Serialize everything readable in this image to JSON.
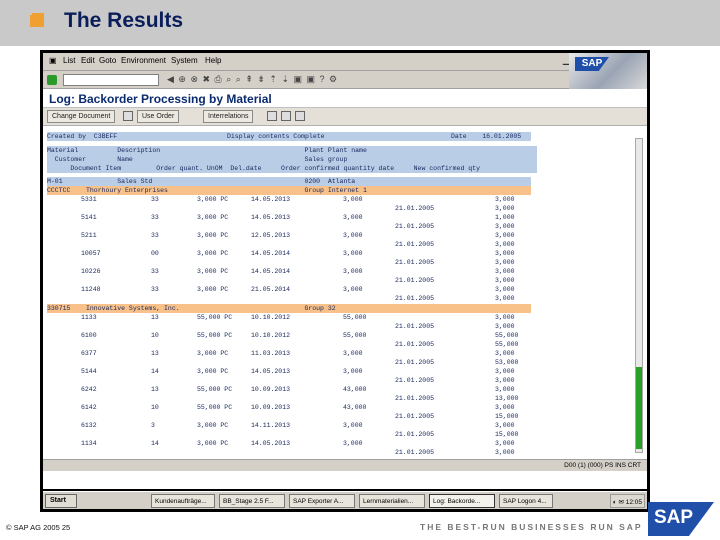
{
  "slide": {
    "title": "The Results",
    "footer_copyright": "© SAP AG 2005 25",
    "footer_tagline": "THE BEST-RUN BUSINESSES RUN SAP",
    "logo_text": "SAP"
  },
  "menu": [
    "List",
    "Edit",
    "Goto",
    "Environment",
    "System",
    "Help"
  ],
  "app": {
    "title": "Log: Backorder Processing by Material",
    "buttons": [
      "Change Document",
      "Use Order",
      "Interrelations"
    ]
  },
  "report": {
    "header_left": "Created by  C3BEFF",
    "header_mid": "Display contents Complete",
    "header_right": "Date    16.01.2005",
    "column_lines": [
      "Material          Description                                     Plant Plant name",
      "  Customer        Name                                            Sales group",
      "      Document Item         Order quant. UnOM  Del.date     Order confirmed quantity date     New confirmed qty"
    ],
    "group1": "M-01              Sales Std                                       0200  Atlanta",
    "customer1": "CCCTCC    Thorhoury Enterprises                                   Group Internet 1",
    "rows1": [
      {
        "doc": "5331",
        "item": "33",
        "qty": "3,000 PC",
        "date": "14.05.2013",
        "conf": "3,000",
        "cdate": "",
        "new": "3,000"
      },
      {
        "doc": "",
        "item": "",
        "qty": "",
        "date": "",
        "conf": "",
        "cdate": "21.01.2005",
        "new": "3,000"
      },
      {
        "doc": "5141",
        "item": "33",
        "qty": "3,000 PC",
        "date": "14.05.2013",
        "conf": "3,000",
        "cdate": "",
        "new": "1,000"
      },
      {
        "doc": "",
        "item": "",
        "qty": "",
        "date": "",
        "conf": "",
        "cdate": "21.01.2005",
        "new": "3,000"
      },
      {
        "doc": "5211",
        "item": "33",
        "qty": "3,000 PC",
        "date": "12.05.2013",
        "conf": "3,000",
        "cdate": "",
        "new": "3,000"
      },
      {
        "doc": "",
        "item": "",
        "qty": "",
        "date": "",
        "conf": "",
        "cdate": "21.01.2005",
        "new": "3,000"
      },
      {
        "doc": "10057",
        "item": "00",
        "qty": "3,000 PC",
        "date": "14.05.2014",
        "conf": "3,000",
        "cdate": "",
        "new": "3,000"
      },
      {
        "doc": "",
        "item": "",
        "qty": "",
        "date": "",
        "conf": "",
        "cdate": "21.01.2005",
        "new": "3,000"
      },
      {
        "doc": "10226",
        "item": "33",
        "qty": "3,000 PC",
        "date": "14.05.2014",
        "conf": "3,000",
        "cdate": "",
        "new": "3,000"
      },
      {
        "doc": "",
        "item": "",
        "qty": "",
        "date": "",
        "conf": "",
        "cdate": "21.01.2005",
        "new": "3,000"
      },
      {
        "doc": "11248",
        "item": "33",
        "qty": "3,000 PC",
        "date": "21.05.2014",
        "conf": "3,000",
        "cdate": "",
        "new": "3,000"
      },
      {
        "doc": "",
        "item": "",
        "qty": "",
        "date": "",
        "conf": "",
        "cdate": "21.01.2005",
        "new": "3,000"
      }
    ],
    "customer2": "330715    Innovative Systems, Inc.                                Group 32",
    "rows2": [
      {
        "doc": "1133",
        "item": "13",
        "qty": "55,000 PC",
        "date": "10.10.2012",
        "conf": "55,000",
        "cdate": "",
        "new": "3,000"
      },
      {
        "doc": "",
        "item": "",
        "qty": "",
        "date": "",
        "conf": "",
        "cdate": "21.01.2005",
        "new": "3,000"
      },
      {
        "doc": "6100",
        "item": "10",
        "qty": "55,000 PC",
        "date": "10.10.2012",
        "conf": "55,000",
        "cdate": "",
        "new": "55,000"
      },
      {
        "doc": "",
        "item": "",
        "qty": "",
        "date": "",
        "conf": "",
        "cdate": "21.01.2005",
        "new": "55,000"
      },
      {
        "doc": "6377",
        "item": "13",
        "qty": "3,000 PC",
        "date": "11.03.2013",
        "conf": "3,000",
        "cdate": "",
        "new": "3,000"
      },
      {
        "doc": "",
        "item": "",
        "qty": "",
        "date": "",
        "conf": "",
        "cdate": "21.01.2005",
        "new": "53,000"
      },
      {
        "doc": "5144",
        "item": "14",
        "qty": "3,000 PC",
        "date": "14.05.2013",
        "conf": "3,000",
        "cdate": "",
        "new": "3,000"
      },
      {
        "doc": "",
        "item": "",
        "qty": "",
        "date": "",
        "conf": "",
        "cdate": "21.01.2005",
        "new": "3,000"
      },
      {
        "doc": "6242",
        "item": "13",
        "qty": "55,000 PC",
        "date": "10.09.2013",
        "conf": "43,000",
        "cdate": "",
        "new": "3,000"
      },
      {
        "doc": "",
        "item": "",
        "qty": "",
        "date": "",
        "conf": "",
        "cdate": "21.01.2005",
        "new": "13,000"
      },
      {
        "doc": "6142",
        "item": "10",
        "qty": "55,000 PC",
        "date": "10.09.2013",
        "conf": "43,000",
        "cdate": "",
        "new": "3,000"
      },
      {
        "doc": "",
        "item": "",
        "qty": "",
        "date": "",
        "conf": "",
        "cdate": "21.01.2005",
        "new": "15,000"
      },
      {
        "doc": "6132",
        "item": "3",
        "qty": "3,000 PC",
        "date": "14.11.2013",
        "conf": "3,000",
        "cdate": "",
        "new": "3,000"
      },
      {
        "doc": "",
        "item": "",
        "qty": "",
        "date": "",
        "conf": "",
        "cdate": "21.01.2005",
        "new": "15,000"
      },
      {
        "doc": "1134",
        "item": "14",
        "qty": "3,000 PC",
        "date": "14.05.2013",
        "conf": "3,000",
        "cdate": "",
        "new": "3,000"
      },
      {
        "doc": "",
        "item": "",
        "qty": "",
        "date": "",
        "conf": "",
        "cdate": "21.01.2005",
        "new": "3,000"
      }
    ]
  },
  "statusbar": "D00 (1) (000)  PS  INS  CRT",
  "taskbar": {
    "start": "Start",
    "tasks": [
      "Kundenaufträge...",
      "BB_Stage 2.5 F...",
      "SAP Exporter A...",
      "Lernmaterialien...",
      "Log: Backorde...",
      "SAP Logon 4..."
    ],
    "clock": "12:05"
  },
  "colors": {
    "header_bar": "#c9c9c9",
    "accent": "#f0a030",
    "title_text": "#0a1e5a",
    "column_header": "#b9cde6",
    "customer_row": "#f7c189",
    "sap_blue": "#1f4fa8"
  }
}
